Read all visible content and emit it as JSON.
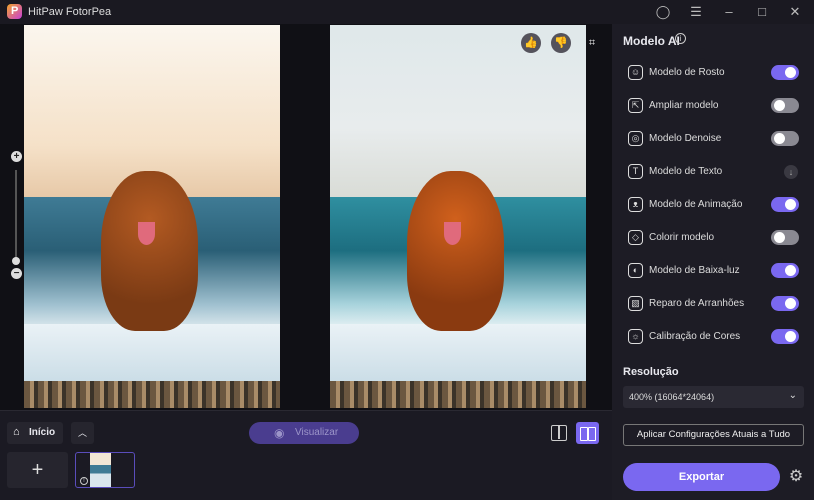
{
  "app": {
    "title": "HitPaw FotorPea"
  },
  "titlebar": {
    "icons": [
      "account-icon",
      "menu-icon",
      "minimize-icon",
      "maximize-icon",
      "close-icon"
    ]
  },
  "canvas": {
    "feedback_icons": [
      "thumbs-up-icon",
      "thumbs-down-icon",
      "crop-icon"
    ]
  },
  "panel": {
    "title": "Modelo AI",
    "models": [
      {
        "label": "Modelo de Rosto",
        "state": "on"
      },
      {
        "label": "Ampliar modelo",
        "state": "off"
      },
      {
        "label": "Modelo Denoise",
        "state": "off"
      },
      {
        "label": "Modelo de Texto",
        "state": "download"
      },
      {
        "label": "Modelo de Animação",
        "state": "on"
      },
      {
        "label": "Colorir modelo",
        "state": "off"
      },
      {
        "label": "Modelo de Baixa-luz",
        "state": "on"
      },
      {
        "label": "Reparo de Arranhões",
        "state": "on"
      },
      {
        "label": "Calibração de Cores",
        "state": "on"
      }
    ],
    "resolution_label": "Resolução",
    "resolution_value": "400% (16064*24064)",
    "apply_label": "Aplicar Configurações Atuais a Tudo",
    "export_label": "Exportar"
  },
  "bottom": {
    "home_label": "Início",
    "preview_label": "Visualizar"
  },
  "colors": {
    "accent": "#7a68f0"
  }
}
